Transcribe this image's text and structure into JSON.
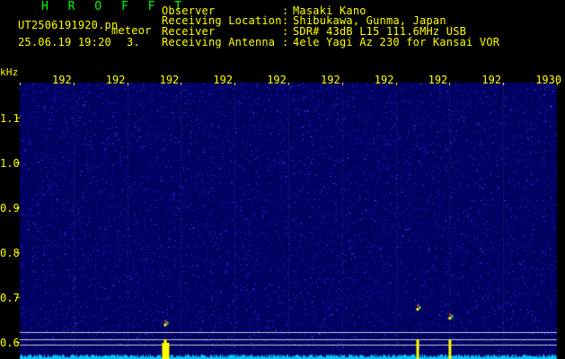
{
  "app": {
    "title": "H R O F F T"
  },
  "header": {
    "file_name": "UT2506191920.pn",
    "mode": "meteor",
    "datetime": "25.06.19 19:20",
    "sequence": "3."
  },
  "metadata": [
    {
      "label": "Observer",
      "value": "Masaki Kano"
    },
    {
      "label": "Receiving Location",
      "value": "Shibukawa, Gunma, Japan"
    },
    {
      "label": "Receiver",
      "value": "SDR# 43dB L15 111.6MHz USB"
    },
    {
      "label": "Receiving Antenna",
      "value": "4ele Yagi Az 230 for Kansai VOR"
    }
  ],
  "axis": {
    "freq_unit": "kHz",
    "freq_ticks": [
      {
        "label": "1.1",
        "value": 1.1
      },
      {
        "label": "1.0",
        "value": 1.0
      },
      {
        "label": "0.9",
        "value": 0.9
      },
      {
        "label": "0.8",
        "value": 0.8
      },
      {
        "label": "0.7",
        "value": 0.7
      },
      {
        "label": "0.6",
        "value": 0.6
      }
    ],
    "time_ticks": [
      "192",
      "192",
      "192",
      "192",
      "192",
      "192",
      "192",
      "192",
      "192",
      "1930"
    ],
    "freq_range": [
      0.6,
      1.16
    ]
  },
  "colors": {
    "background": "#000000",
    "text": "#ffff00",
    "title": "#00ff00",
    "waterfall_bg": "#000060",
    "noise_floor": "#00c8ff",
    "meteor": "#ffff00",
    "guide_line": "#c8c8c8"
  },
  "events": [
    {
      "minute": 1922.6,
      "freq": 0.645,
      "kind": "echo"
    },
    {
      "minute": 1927.3,
      "freq": 0.68,
      "kind": "echo"
    },
    {
      "minute": 1927.9,
      "freq": 0.66,
      "kind": "echo"
    }
  ]
}
